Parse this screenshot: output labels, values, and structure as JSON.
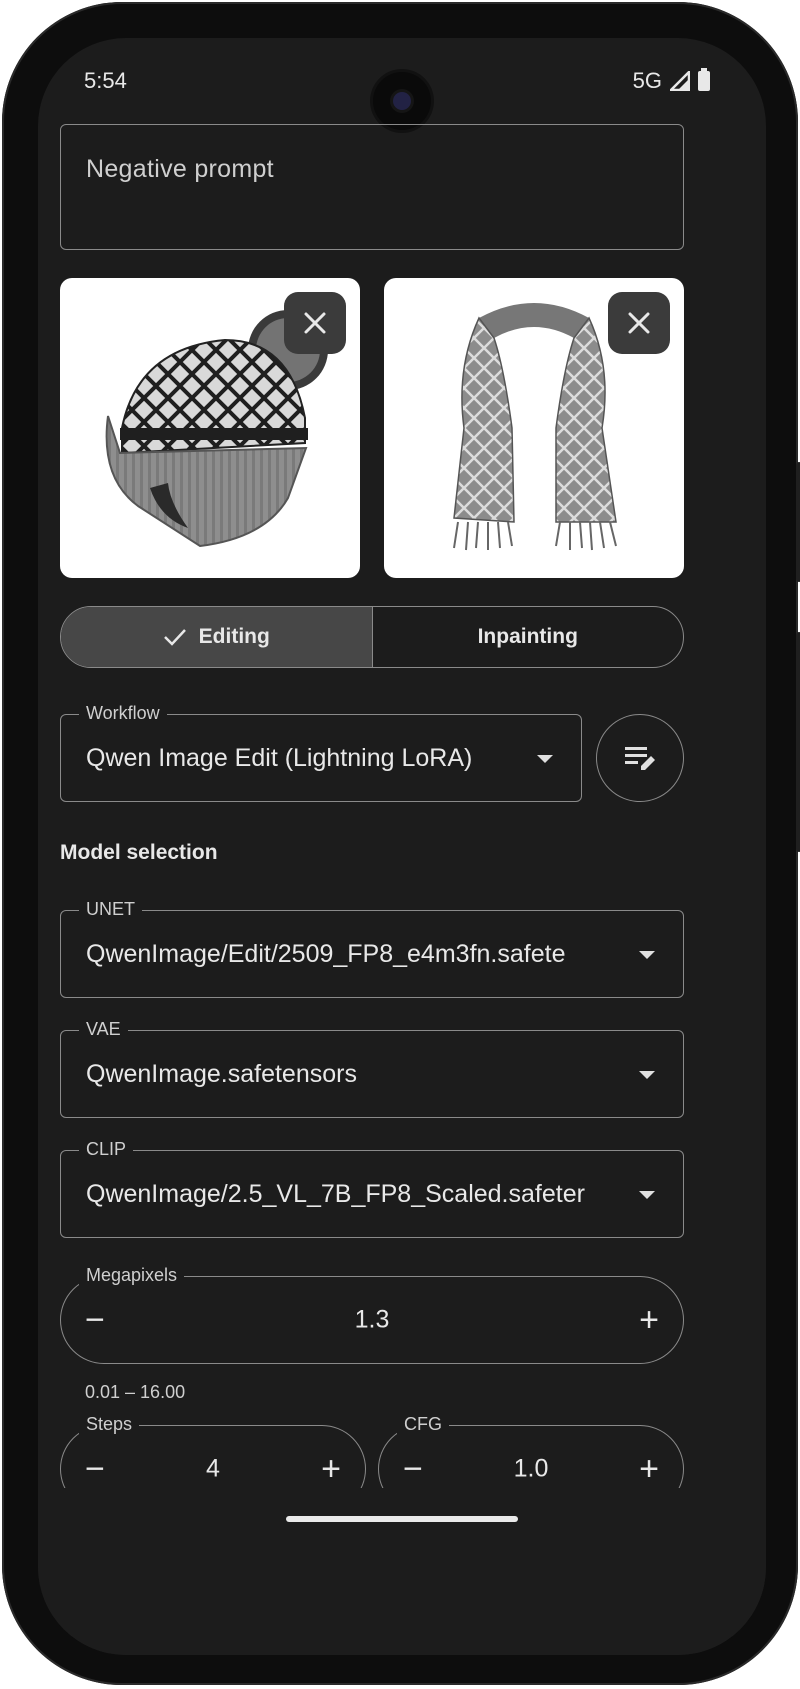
{
  "status_bar": {
    "time": "5:54",
    "network": "5G"
  },
  "negative_prompt": {
    "placeholder": "Negative prompt"
  },
  "images": [
    {
      "name": "beanie-hat-image"
    },
    {
      "name": "scarf-image"
    }
  ],
  "mode_toggle": {
    "options": [
      "Editing",
      "Inpainting"
    ],
    "selected": "Editing"
  },
  "workflow": {
    "label": "Workflow",
    "value": "Qwen Image Edit (Lightning LoRA)"
  },
  "model_selection": {
    "title": "Model selection",
    "unet": {
      "label": "UNET",
      "value": "QwenImage/Edit/2509_FP8_e4m3fn.safete"
    },
    "vae": {
      "label": "VAE",
      "value": "QwenImage.safetensors"
    },
    "clip": {
      "label": "CLIP",
      "value": "QwenImage/2.5_VL_7B_FP8_Scaled.safeter"
    }
  },
  "megapixels": {
    "label": "Megapixels",
    "value": "1.3",
    "range": "0.01 – 16.00"
  },
  "steps": {
    "label": "Steps",
    "value": "4"
  },
  "cfg": {
    "label": "CFG",
    "value": "1.0"
  },
  "colors": {
    "background": "#1c1c1c",
    "outline": "#8a8a8a",
    "selected_segment": "#474747"
  }
}
